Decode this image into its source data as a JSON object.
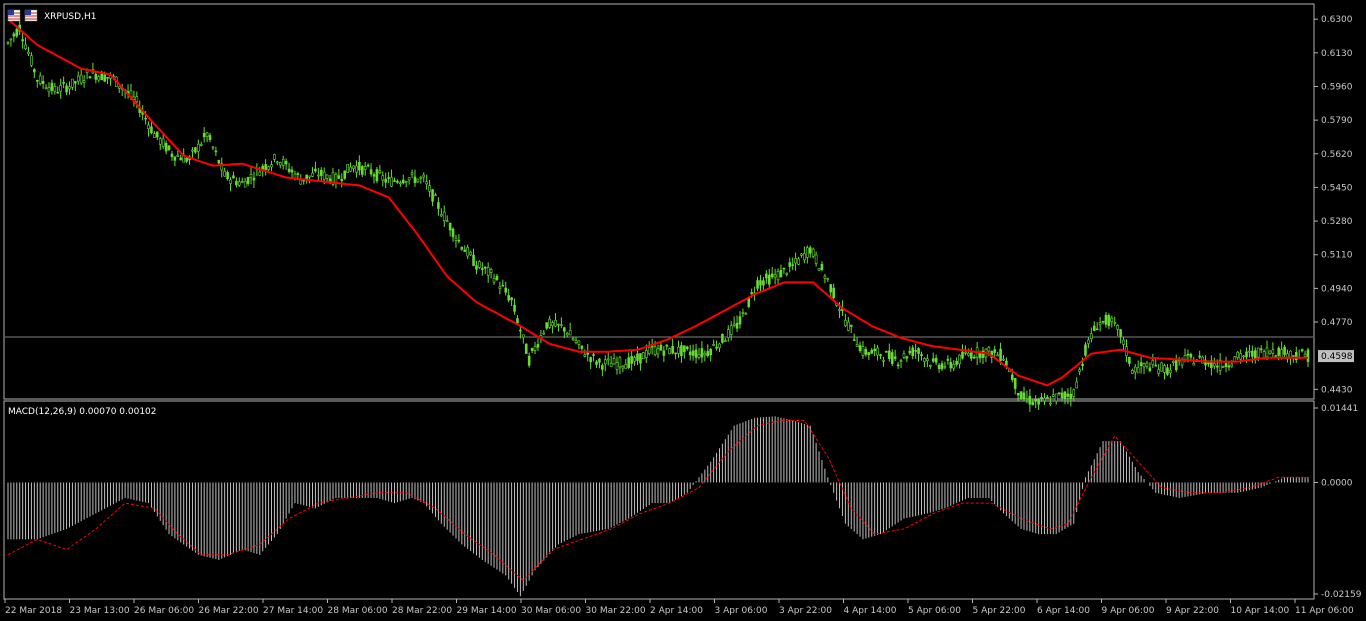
{
  "window": {
    "symbol_label": "XRPUSD,H1",
    "flag_icon": "us-flag-icon",
    "background": "#000000"
  },
  "colors": {
    "bull_candle": "#66dd33",
    "ma_line": "#ff0000",
    "macd_hist": "#c0c0c0",
    "macd_signal": "#ff0000",
    "grid_line": "#808080",
    "price_badge": "#c0c0c0"
  },
  "chart_data": [
    {
      "type": "candlestick",
      "title": "XRPUSD,H1",
      "y_ticks": [
        "0.6300",
        "0.6130",
        "0.5960",
        "0.5790",
        "0.5620",
        "0.5450",
        "0.5280",
        "0.5110",
        "0.4940",
        "0.4770",
        "0.4598",
        "0.4430"
      ],
      "ylim": [
        0.4366,
        0.6316
      ],
      "current_price": "0.4598",
      "x_tick_labels": [
        "22 Mar 2018",
        "23 Mar 13:00",
        "26 Mar 06:00",
        "26 Mar 22:00",
        "27 Mar 14:00",
        "28 Mar 06:00",
        "28 Mar 22:00",
        "29 Mar 14:00",
        "30 Mar 06:00",
        "30 Mar 22:00",
        "2 Apr 14:00",
        "3 Apr 06:00",
        "3 Apr 22:00",
        "4 Apr 14:00",
        "5 Apr 06:00",
        "5 Apr 22:00",
        "6 Apr 14:00",
        "9 Apr 06:00",
        "9 Apr 22:00",
        "10 Apr 14:00",
        "11 Apr 06:00"
      ],
      "price_anchors": [
        [
          0,
          0.618
        ],
        [
          4,
          0.626
        ],
        [
          10,
          0.6
        ],
        [
          16,
          0.594
        ],
        [
          22,
          0.597
        ],
        [
          28,
          0.603
        ],
        [
          36,
          0.6
        ],
        [
          44,
          0.588
        ],
        [
          50,
          0.572
        ],
        [
          56,
          0.562
        ],
        [
          62,
          0.559
        ],
        [
          68,
          0.572
        ],
        [
          74,
          0.551
        ],
        [
          80,
          0.547
        ],
        [
          86,
          0.554
        ],
        [
          92,
          0.56
        ],
        [
          100,
          0.549
        ],
        [
          106,
          0.552
        ],
        [
          112,
          0.549
        ],
        [
          118,
          0.556
        ],
        [
          124,
          0.553
        ],
        [
          130,
          0.548
        ],
        [
          136,
          0.55
        ],
        [
          142,
          0.549
        ],
        [
          148,
          0.533
        ],
        [
          154,
          0.518
        ],
        [
          160,
          0.506
        ],
        [
          166,
          0.5
        ],
        [
          172,
          0.488
        ],
        [
          178,
          0.458
        ],
        [
          184,
          0.476
        ],
        [
          190,
          0.474
        ],
        [
          196,
          0.463
        ],
        [
          202,
          0.456
        ],
        [
          208,
          0.456
        ],
        [
          214,
          0.457
        ],
        [
          220,
          0.463
        ],
        [
          226,
          0.463
        ],
        [
          232,
          0.462
        ],
        [
          238,
          0.461
        ],
        [
          244,
          0.468
        ],
        [
          250,
          0.477
        ],
        [
          256,
          0.497
        ],
        [
          262,
          0.5
        ],
        [
          268,
          0.505
        ],
        [
          274,
          0.514
        ],
        [
          280,
          0.498
        ],
        [
          286,
          0.478
        ],
        [
          292,
          0.462
        ],
        [
          298,
          0.461
        ],
        [
          304,
          0.458
        ],
        [
          310,
          0.463
        ],
        [
          316,
          0.456
        ],
        [
          322,
          0.455
        ],
        [
          328,
          0.461
        ],
        [
          334,
          0.462
        ],
        [
          340,
          0.46
        ],
        [
          346,
          0.439
        ],
        [
          352,
          0.436
        ],
        [
          358,
          0.439
        ],
        [
          364,
          0.441
        ],
        [
          368,
          0.463
        ],
        [
          372,
          0.476
        ],
        [
          376,
          0.478
        ],
        [
          380,
          0.471
        ],
        [
          384,
          0.453
        ],
        [
          390,
          0.455
        ],
        [
          396,
          0.453
        ],
        [
          402,
          0.458
        ],
        [
          408,
          0.458
        ],
        [
          414,
          0.455
        ],
        [
          420,
          0.459
        ],
        [
          426,
          0.461
        ],
        [
          432,
          0.463
        ],
        [
          438,
          0.461
        ],
        [
          444,
          0.46
        ]
      ],
      "ma_anchors": [
        [
          0,
          0.63
        ],
        [
          10,
          0.617
        ],
        [
          25,
          0.605
        ],
        [
          35,
          0.602
        ],
        [
          50,
          0.577
        ],
        [
          60,
          0.561
        ],
        [
          70,
          0.556
        ],
        [
          80,
          0.557
        ],
        [
          95,
          0.55
        ],
        [
          120,
          0.546
        ],
        [
          130,
          0.54
        ],
        [
          140,
          0.521
        ],
        [
          150,
          0.5
        ],
        [
          160,
          0.487
        ],
        [
          175,
          0.475
        ],
        [
          185,
          0.466
        ],
        [
          195,
          0.462
        ],
        [
          205,
          0.462
        ],
        [
          215,
          0.463
        ],
        [
          225,
          0.468
        ],
        [
          235,
          0.475
        ],
        [
          245,
          0.483
        ],
        [
          255,
          0.491
        ],
        [
          265,
          0.497
        ],
        [
          275,
          0.497
        ],
        [
          285,
          0.484
        ],
        [
          295,
          0.475
        ],
        [
          305,
          0.469
        ],
        [
          315,
          0.465
        ],
        [
          325,
          0.463
        ],
        [
          335,
          0.461
        ],
        [
          345,
          0.45
        ],
        [
          355,
          0.445
        ],
        [
          360,
          0.449
        ],
        [
          370,
          0.461
        ],
        [
          380,
          0.463
        ],
        [
          390,
          0.459
        ],
        [
          400,
          0.458
        ],
        [
          410,
          0.457
        ],
        [
          420,
          0.457
        ],
        [
          430,
          0.459
        ],
        [
          444,
          0.459
        ]
      ]
    },
    {
      "type": "histogram",
      "title": "MACD(12,26,9) 0.00070 0.00102",
      "y_ticks": [
        "0.01441",
        "0.0000",
        "-0.02159"
      ],
      "ylim": [
        -0.02159,
        0.01441
      ],
      "macd_anchors": [
        [
          0,
          -0.011
        ],
        [
          10,
          -0.011
        ],
        [
          20,
          -0.009
        ],
        [
          30,
          -0.006
        ],
        [
          40,
          -0.003
        ],
        [
          48,
          -0.004
        ],
        [
          55,
          -0.01
        ],
        [
          65,
          -0.014
        ],
        [
          72,
          -0.015
        ],
        [
          80,
          -0.013
        ],
        [
          86,
          -0.014
        ],
        [
          92,
          -0.01
        ],
        [
          98,
          -0.004
        ],
        [
          105,
          -0.005
        ],
        [
          112,
          -0.003
        ],
        [
          120,
          -0.003
        ],
        [
          126,
          -0.003
        ],
        [
          132,
          -0.004
        ],
        [
          138,
          -0.003
        ],
        [
          142,
          -0.004
        ],
        [
          148,
          -0.008
        ],
        [
          155,
          -0.012
        ],
        [
          162,
          -0.015
        ],
        [
          170,
          -0.018
        ],
        [
          175,
          -0.022
        ],
        [
          180,
          -0.017
        ],
        [
          188,
          -0.012
        ],
        [
          195,
          -0.01
        ],
        [
          205,
          -0.009
        ],
        [
          212,
          -0.007
        ],
        [
          220,
          -0.004
        ],
        [
          226,
          -0.004
        ],
        [
          232,
          -0.002
        ],
        [
          240,
          0.004
        ],
        [
          248,
          0.011
        ],
        [
          255,
          0.0125
        ],
        [
          262,
          0.0128
        ],
        [
          268,
          0.012
        ],
        [
          274,
          0.011
        ],
        [
          280,
          0.001
        ],
        [
          286,
          -0.008
        ],
        [
          292,
          -0.011
        ],
        [
          298,
          -0.01
        ],
        [
          306,
          -0.007
        ],
        [
          314,
          -0.006
        ],
        [
          320,
          -0.005
        ],
        [
          328,
          -0.003
        ],
        [
          335,
          -0.003
        ],
        [
          340,
          -0.006
        ],
        [
          346,
          -0.009
        ],
        [
          352,
          -0.01
        ],
        [
          358,
          -0.01
        ],
        [
          364,
          -0.008
        ],
        [
          368,
          0.001
        ],
        [
          374,
          0.008
        ],
        [
          380,
          0.008
        ],
        [
          386,
          0.002
        ],
        [
          392,
          -0.002
        ],
        [
          400,
          -0.003
        ],
        [
          410,
          -0.002
        ],
        [
          420,
          -0.002
        ],
        [
          428,
          -0.001
        ],
        [
          436,
          0.001
        ],
        [
          444,
          0.001
        ]
      ],
      "signal_anchors": [
        [
          0,
          -0.014
        ],
        [
          10,
          -0.011
        ],
        [
          20,
          -0.013
        ],
        [
          30,
          -0.009
        ],
        [
          40,
          -0.004
        ],
        [
          50,
          -0.005
        ],
        [
          58,
          -0.01
        ],
        [
          66,
          -0.014
        ],
        [
          75,
          -0.014
        ],
        [
          86,
          -0.012
        ],
        [
          96,
          -0.007
        ],
        [
          106,
          -0.004
        ],
        [
          116,
          -0.003
        ],
        [
          126,
          -0.002
        ],
        [
          136,
          -0.002
        ],
        [
          146,
          -0.005
        ],
        [
          156,
          -0.01
        ],
        [
          166,
          -0.014
        ],
        [
          176,
          -0.019
        ],
        [
          186,
          -0.013
        ],
        [
          196,
          -0.011
        ],
        [
          206,
          -0.009
        ],
        [
          216,
          -0.006
        ],
        [
          226,
          -0.004
        ],
        [
          236,
          -0.001
        ],
        [
          246,
          0.006
        ],
        [
          256,
          0.011
        ],
        [
          264,
          0.012
        ],
        [
          272,
          0.012
        ],
        [
          280,
          0.005
        ],
        [
          288,
          -0.005
        ],
        [
          296,
          -0.01
        ],
        [
          306,
          -0.009
        ],
        [
          316,
          -0.006
        ],
        [
          326,
          -0.004
        ],
        [
          336,
          -0.004
        ],
        [
          346,
          -0.007
        ],
        [
          356,
          -0.009
        ],
        [
          362,
          -0.008
        ],
        [
          370,
          0.001
        ],
        [
          378,
          0.009
        ],
        [
          386,
          0.004
        ],
        [
          394,
          -0.001
        ],
        [
          404,
          -0.002
        ],
        [
          414,
          -0.002
        ],
        [
          424,
          -0.001
        ],
        [
          434,
          0.001
        ],
        [
          444,
          0.001
        ]
      ]
    }
  ]
}
